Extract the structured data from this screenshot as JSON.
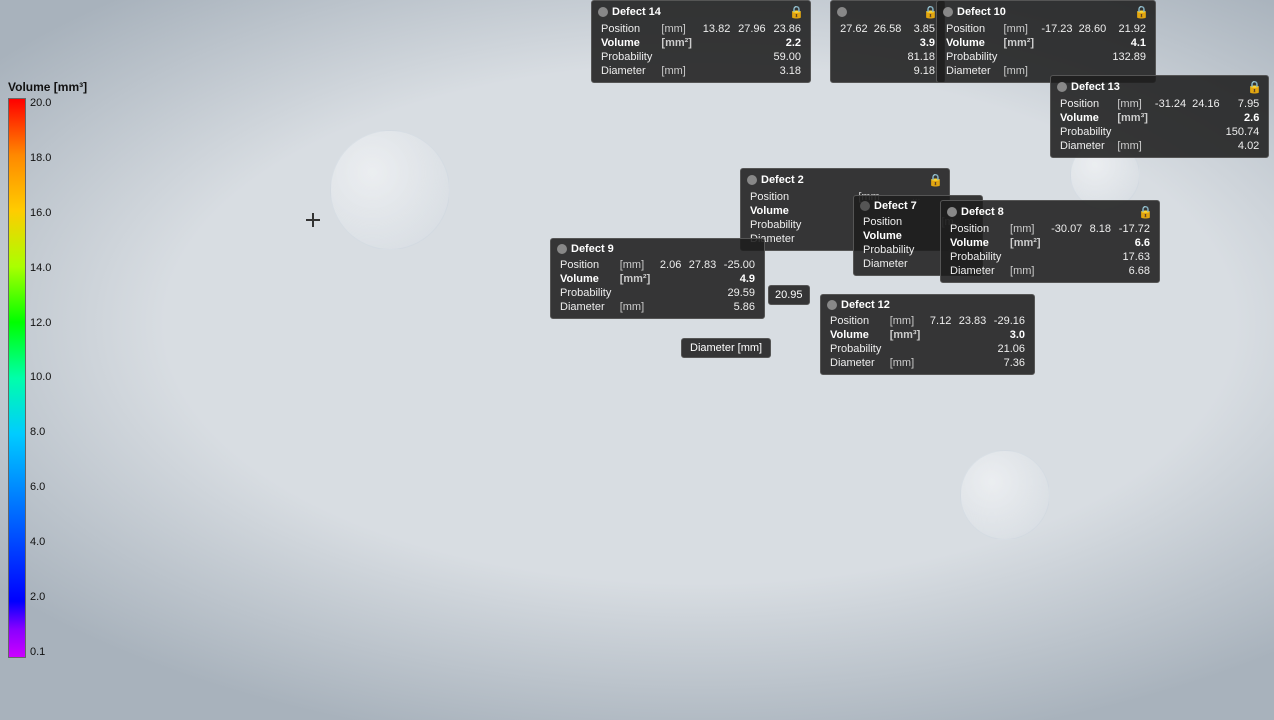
{
  "legend": {
    "title": "Volume [mm³]",
    "labels": [
      "20.0",
      "18.0",
      "16.0",
      "14.0",
      "12.0",
      "10.0",
      "8.0",
      "6.0",
      "4.0",
      "2.0",
      "0.1"
    ]
  },
  "defects": {
    "defect14": {
      "title": "Defect 14",
      "position_label": "Position",
      "position_unit": "[mm]",
      "position_x": "13.82",
      "position_y": "27.96",
      "position_z": "23.86",
      "volume_label": "Volume",
      "volume_unit": "[mm²]",
      "volume_val": "2.2",
      "probability_label": "Probability",
      "probability_val": "59.00",
      "diameter_label": "Diameter",
      "diameter_unit": "[mm]",
      "diameter_val": "3.18"
    },
    "defect14b": {
      "position_x": "27.62",
      "position_y": "26.58",
      "position_z": "3.85",
      "volume_val": "3.9",
      "probability_val": "81.18",
      "diameter_val": "9.18"
    },
    "defect10": {
      "title": "Defect 10",
      "position_label": "Position",
      "position_unit": "[mm]",
      "position_x": "-17.23",
      "position_y": "28.60",
      "position_z": "21.92",
      "volume_label": "Volume",
      "volume_unit": "[mm²]",
      "volume_val": "4.1",
      "probability_label": "Probability",
      "probability_val": "132.89",
      "diameter_label": "Diameter",
      "diameter_unit": "[mm]",
      "diameter_val": ""
    },
    "defect13": {
      "title": "Defect 13",
      "position_label": "Position",
      "position_unit": "[mm]",
      "position_x": "-31.24",
      "position_y": "24.16",
      "position_z": "7.95",
      "volume_label": "Volume",
      "volume_unit": "[mm³]",
      "volume_val": "2.6",
      "probability_label": "Probability",
      "probability_val": "150.74",
      "diameter_label": "Diameter",
      "diameter_unit": "[mm]",
      "diameter_val": "4.02"
    },
    "defect2": {
      "title": "Defect 2",
      "position_label": "Position",
      "position_unit": "[mm",
      "volume_label": "Volume",
      "volume_unit": "",
      "probability_label": "Probability",
      "diameter_label": "Diameter"
    },
    "defect7": {
      "title": "Defect 7",
      "position_label": "Position",
      "volume_label": "Volume",
      "probability_label": "Probability",
      "diameter_label": "Diameter"
    },
    "defect8": {
      "title": "Defect 8",
      "position_label": "Position",
      "position_unit": "[mm]",
      "position_x": "-30.07",
      "position_y": "8.18",
      "position_z": "-17.72",
      "volume_label": "Volume",
      "volume_unit": "[mm²]",
      "volume_val": "6.6",
      "probability_label": "Probability",
      "probability_val": "17.63",
      "diameter_label": "Diameter",
      "diameter_unit": "[mm]",
      "diameter_val": "6.68"
    },
    "defect9": {
      "title": "Defect 9",
      "position_label": "Position",
      "position_unit": "[mm]",
      "position_x": "2.06",
      "position_y": "27.83",
      "position_z": "-25.00",
      "volume_label": "Volume",
      "volume_unit": "[mm²]",
      "volume_val": "4.9",
      "probability_label": "Probability",
      "probability_val": "29.59",
      "diameter_label": "Diameter",
      "diameter_unit": "[mm]",
      "diameter_val": "5.86"
    },
    "defect12": {
      "title": "Defect 12",
      "position_label": "Position",
      "position_unit": "[mm]",
      "position_x": "7.12",
      "position_y": "23.83",
      "position_z": "-29.16",
      "volume_label": "Volume",
      "volume_unit": "[mm³]",
      "volume_val": "3.0",
      "probability_label": "Probability",
      "probability_val": "21.06",
      "diameter_label": "Diameter",
      "diameter_unit": "[mm]",
      "diameter_val": "7.36"
    }
  },
  "floating_labels": {
    "diameter": "Diameter   [mm]"
  },
  "partial_values": {
    "val_20_95": "20.95",
    "val_3": "3"
  }
}
